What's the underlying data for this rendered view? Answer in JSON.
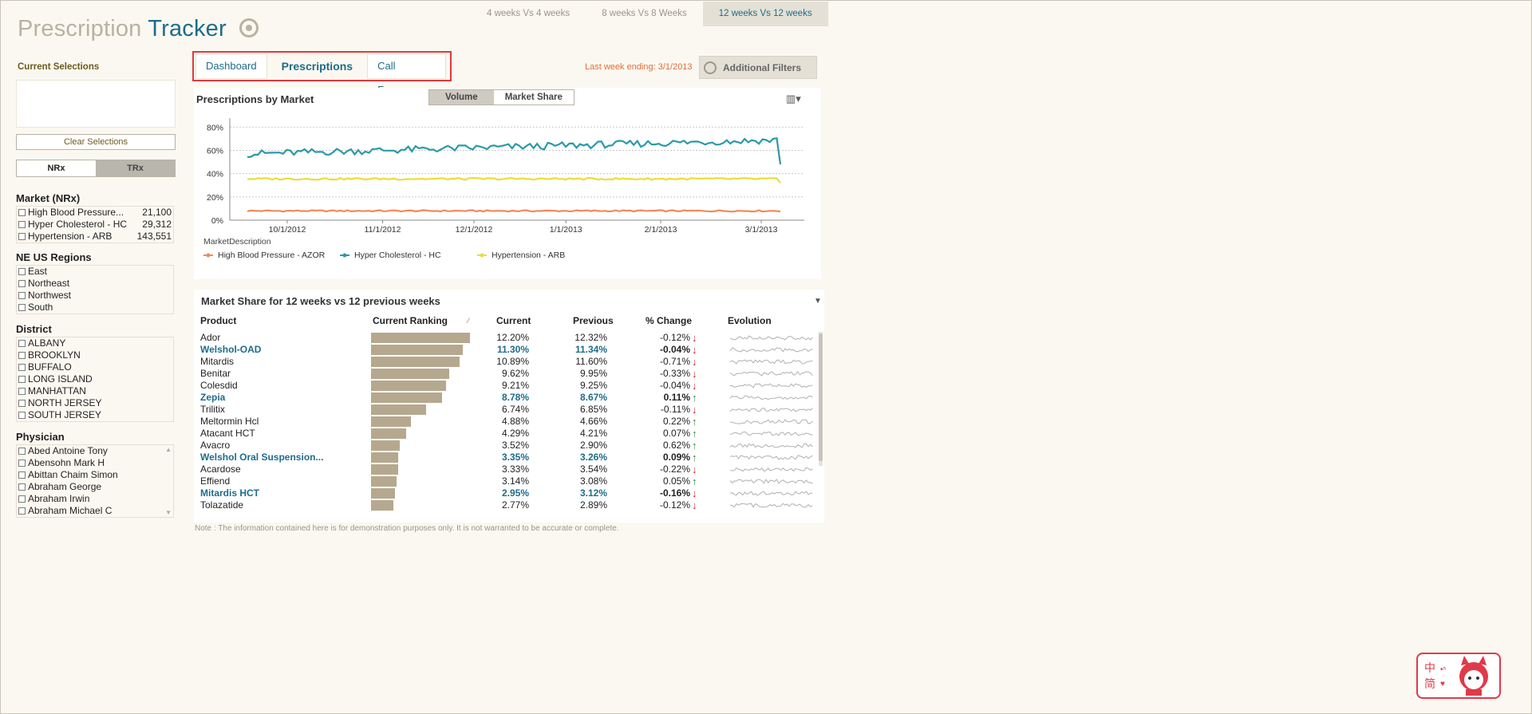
{
  "app": {
    "title_part1": "Prescription",
    "title_part2": "Tracker",
    "top_tabs": [
      "4 weeks Vs 4 weeks",
      "8 weeks Vs 8 Weeks",
      "12 weeks Vs 12 weeks"
    ],
    "active_top_tab": 2
  },
  "left_panel": {
    "current_selections_label": "Current Selections",
    "clear_selections_label": "Clear Selections",
    "toggle": {
      "left": "NRx",
      "right": "TRx"
    },
    "market": {
      "header": "Market (NRx)",
      "items": [
        {
          "name": "High Blood Pressure...",
          "value": "21,100"
        },
        {
          "name": "Hyper Cholesterol - HC",
          "value": "29,312"
        },
        {
          "name": "Hypertension - ARB",
          "value": "143,551"
        }
      ]
    },
    "regions": {
      "header": "NE US Regions",
      "items": [
        "East",
        "Northeast",
        "Northwest",
        "South"
      ]
    },
    "district": {
      "header": "District",
      "items": [
        "ALBANY",
        "BROOKLYN",
        "BUFFALO",
        "LONG ISLAND",
        "MANHATTAN",
        "NORTH JERSEY",
        "SOUTH JERSEY"
      ]
    },
    "physician": {
      "header": "Physician",
      "items": [
        "Abed Antoine Tony",
        "Abensohn Mark H",
        "Abittan Chaim Simon",
        "Abraham George",
        "Abraham Irwin",
        "Abraham Michael C"
      ]
    }
  },
  "main": {
    "tabs": [
      "Dashboard",
      "Prescriptions",
      "Call Frequency"
    ],
    "active_tab": 1,
    "last_week_text": "Last week ending: 3/1/2013",
    "additional_filters_label": "Additional Filters",
    "chart_title": "Prescriptions by Market",
    "chart_toggle": {
      "on": "Volume",
      "off": "Market Share"
    },
    "legend_title": "MarketDescription",
    "table_title": "Market Share for 12 weeks vs 12 previous weeks",
    "columns": [
      "Product",
      "Current Ranking",
      "Current",
      "Previous",
      "% Change",
      "Evolution"
    ],
    "rows": [
      {
        "product": "Ador",
        "current": "12.20%",
        "previous": "12.32%",
        "change": "-0.12%",
        "dir": "down",
        "hl": false,
        "rank": 12.2
      },
      {
        "product": "Welshol-OAD",
        "current": "11.30%",
        "previous": "11.34%",
        "change": "-0.04%",
        "dir": "down",
        "hl": true,
        "rank": 11.3
      },
      {
        "product": "Mitardis",
        "current": "10.89%",
        "previous": "11.60%",
        "change": "-0.71%",
        "dir": "down",
        "hl": false,
        "rank": 10.89
      },
      {
        "product": "Benitar",
        "current": "9.62%",
        "previous": "9.95%",
        "change": "-0.33%",
        "dir": "down",
        "hl": false,
        "rank": 9.62
      },
      {
        "product": "Colesdid",
        "current": "9.21%",
        "previous": "9.25%",
        "change": "-0.04%",
        "dir": "down",
        "hl": false,
        "rank": 9.21
      },
      {
        "product": "Zepia",
        "current": "8.78%",
        "previous": "8.67%",
        "change": "0.11%",
        "dir": "up",
        "hl": true,
        "rank": 8.78
      },
      {
        "product": "Trilitix",
        "current": "6.74%",
        "previous": "6.85%",
        "change": "-0.11%",
        "dir": "down",
        "hl": false,
        "rank": 6.74
      },
      {
        "product": "Meltormin Hcl",
        "current": "4.88%",
        "previous": "4.66%",
        "change": "0.22%",
        "dir": "up",
        "hl": false,
        "rank": 4.88
      },
      {
        "product": "Atacant HCT",
        "current": "4.29%",
        "previous": "4.21%",
        "change": "0.07%",
        "dir": "up",
        "hl": false,
        "rank": 4.29
      },
      {
        "product": "Avacro",
        "current": "3.52%",
        "previous": "2.90%",
        "change": "0.62%",
        "dir": "up",
        "hl": false,
        "rank": 3.52
      },
      {
        "product": "Welshol Oral Suspension...",
        "current": "3.35%",
        "previous": "3.26%",
        "change": "0.09%",
        "dir": "up",
        "hl": true,
        "rank": 3.35
      },
      {
        "product": "Acardose",
        "current": "3.33%",
        "previous": "3.54%",
        "change": "-0.22%",
        "dir": "down",
        "hl": false,
        "rank": 3.33
      },
      {
        "product": "Effiend",
        "current": "3.14%",
        "previous": "3.08%",
        "change": "0.05%",
        "dir": "up",
        "hl": false,
        "rank": 3.14
      },
      {
        "product": "Mitardis HCT",
        "current": "2.95%",
        "previous": "3.12%",
        "change": "-0.16%",
        "dir": "down",
        "hl": true,
        "rank": 2.95
      },
      {
        "product": "Tolazatide",
        "current": "2.77%",
        "previous": "2.89%",
        "change": "-0.12%",
        "dir": "down",
        "hl": false,
        "rank": 2.77
      }
    ],
    "note": "Note : The information contained here is for demonstration purposes only.  It is not warranted to be accurate or complete."
  },
  "chart_data": {
    "type": "line",
    "title": "Prescriptions by Market",
    "x_ticks": [
      "10/1/2012",
      "11/1/2012",
      "12/1/2012",
      "1/1/2013",
      "2/1/2013",
      "3/1/2013"
    ],
    "y_ticks": [
      "80%",
      "60%",
      "40%",
      "20%",
      "0%"
    ],
    "ylim": [
      0,
      0.85
    ],
    "grid": true,
    "legend_position": "bottom-left",
    "series": [
      {
        "name": "High Blood Pressure - AZOR",
        "color": "#f08a5d",
        "base": 0.08,
        "amp": 0.006
      },
      {
        "name": "Hyper Cholesterol - HC",
        "color": "#2a9aa8",
        "base": 0.57,
        "amp": 0.03,
        "trend": 0.12,
        "end": 0.48
      },
      {
        "name": "Hypertension - ARB",
        "color": "#ecdc3a",
        "base": 0.355,
        "amp": 0.008,
        "end": 0.32
      }
    ],
    "colors": {
      "accent": "#1e6c8a",
      "bar": "#b5a88e",
      "down": "#d42020",
      "up": "#2a8a3a"
    }
  }
}
